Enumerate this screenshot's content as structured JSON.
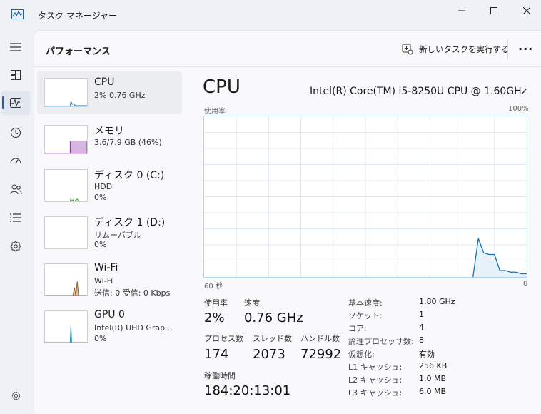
{
  "window": {
    "title": "タスク マネージャー"
  },
  "header": {
    "page_title": "パフォーマンス",
    "run_task_label": "新しいタスクを実行する",
    "more_label": "···"
  },
  "rail": {
    "items": [
      "menu-icon",
      "processes-icon",
      "performance-icon",
      "app-history-icon",
      "startup-icon",
      "users-icon",
      "details-icon",
      "services-icon",
      "settings-icon"
    ],
    "active": "performance-icon"
  },
  "devices": [
    {
      "name": "CPU",
      "line1": "2%  0.76 GHz",
      "line2": "",
      "color": "#1170b8"
    },
    {
      "name": "メモリ",
      "line1": "3.6/7.9 GB (46%)",
      "line2": "",
      "color": "#8b2fa4"
    },
    {
      "name": "ディスク 0 (C:)",
      "line1": "HDD",
      "line2": "0%",
      "color": "#4aa02c"
    },
    {
      "name": "ディスク 1 (D:)",
      "line1": "リムーバブル",
      "line2": "0%",
      "color": "#4aa02c"
    },
    {
      "name": "Wi-Fi",
      "line1": "Wi-Fi",
      "line2": "送信: 0  受信: 0 Kbps",
      "color": "#a05a16"
    },
    {
      "name": "GPU 0",
      "line1": "Intel(R) UHD Grap...",
      "line2": "0%",
      "color": "#1d8fb0"
    }
  ],
  "detail": {
    "title": "CPU",
    "model": "Intel(R) Core(TM) i5-8250U CPU @ 1.60GHz",
    "graph_label": "使用率",
    "graph_max": "100%",
    "x_left": "60 秒",
    "x_right": "0"
  },
  "chart_data": {
    "type": "area",
    "ylabel": "使用率",
    "ylim": [
      0,
      100
    ],
    "xlim": [
      60,
      0
    ],
    "color": "#1170b8",
    "grid": true,
    "x": [
      60,
      59,
      58,
      57,
      56,
      55,
      54,
      53,
      52,
      51,
      50,
      49,
      48,
      47,
      46,
      45,
      44,
      43,
      42,
      41,
      40,
      39,
      38,
      37,
      36,
      35,
      34,
      33,
      32,
      31,
      30,
      29,
      28,
      27,
      26,
      25,
      24,
      23,
      22,
      21,
      20,
      19,
      18,
      17,
      16,
      15,
      14,
      13,
      12,
      11,
      10,
      9,
      8,
      7,
      6,
      5,
      4,
      3,
      2,
      1,
      0
    ],
    "y": [
      0,
      0,
      0,
      0,
      0,
      0,
      0,
      0,
      0,
      0,
      0,
      0,
      0,
      0,
      0,
      0,
      0,
      0,
      0,
      0,
      0,
      0,
      0,
      0,
      0,
      0,
      0,
      0,
      0,
      0,
      0,
      0,
      0,
      0,
      0,
      0,
      0,
      0,
      0,
      0,
      0,
      0,
      0,
      0,
      0,
      0,
      0,
      0,
      0,
      0,
      0,
      24,
      15,
      14,
      14,
      4,
      4,
      3,
      3,
      2,
      2
    ],
    "y_smooth_note": ""
  },
  "stats": {
    "usage_label": "使用率",
    "usage_value": "2%",
    "speed_label": "速度",
    "speed_value": "0.76 GHz",
    "processes_label": "プロセス数",
    "processes_value": "174",
    "threads_label": "スレッド数",
    "threads_value": "2073",
    "handles_label": "ハンドル数",
    "handles_value": "72992",
    "uptime_label": "稼働時間",
    "uptime_value": "184:20:13:01"
  },
  "specs": [
    {
      "key": "基本速度:",
      "value": "1.80 GHz"
    },
    {
      "key": "ソケット:",
      "value": "1"
    },
    {
      "key": "コア:",
      "value": "4"
    },
    {
      "key": "論理プロセッサ数:",
      "value": "8"
    },
    {
      "key": "仮想化:",
      "value": "有効"
    },
    {
      "key": "L1 キャッシュ:",
      "value": "256 KB"
    },
    {
      "key": "L2 キャッシュ:",
      "value": "1.0 MB"
    },
    {
      "key": "L3 キャッシュ:",
      "value": "6.0 MB"
    }
  ]
}
